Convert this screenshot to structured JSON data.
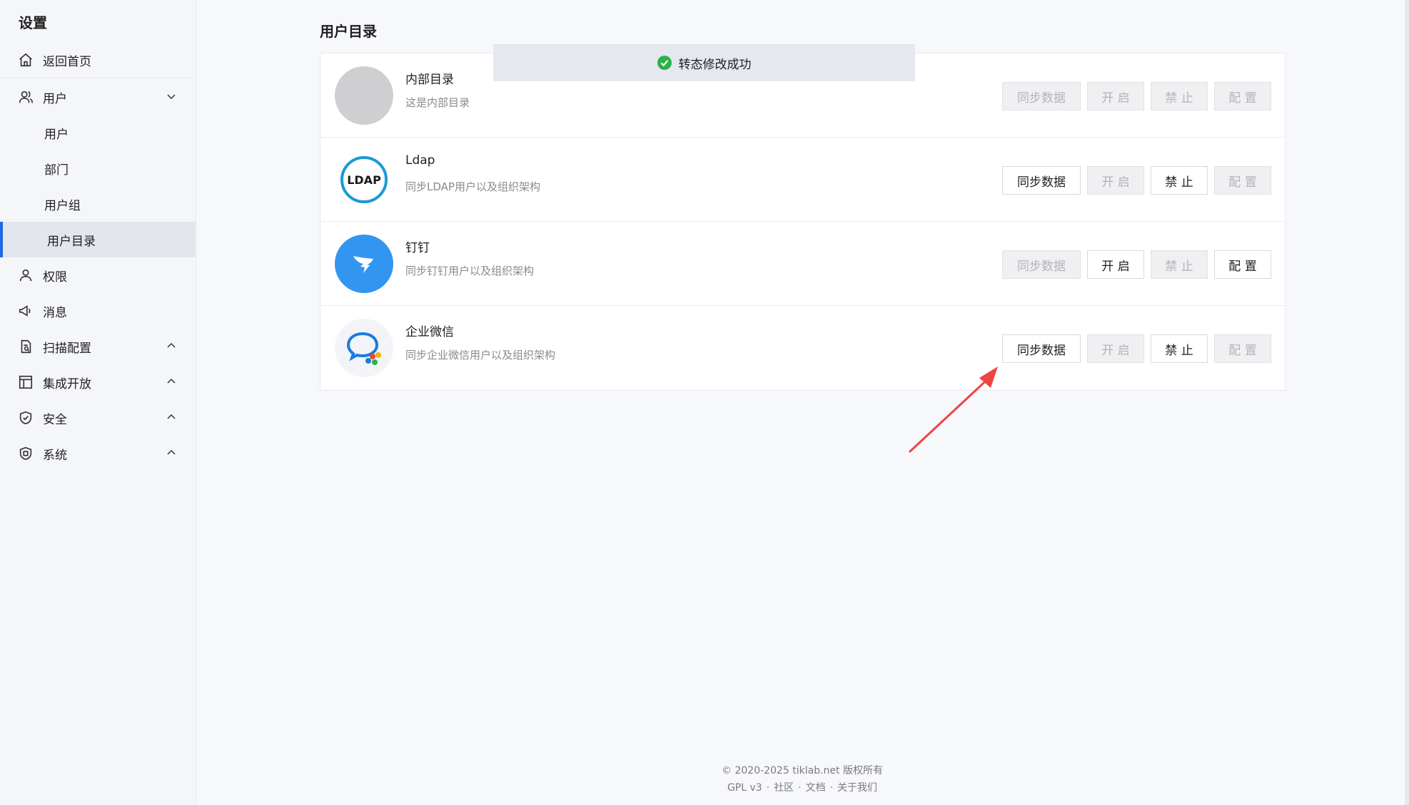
{
  "sidebar": {
    "title": "设置",
    "home": "返回首页",
    "users_group": "用户",
    "sub_items": [
      "用户",
      "部门",
      "用户组",
      "用户目录"
    ],
    "permission": "权限",
    "message": "消息",
    "scan_config": "扫描配置",
    "integration": "集成开放",
    "security": "安全",
    "system": "系统"
  },
  "main": {
    "title": "用户目录",
    "rows": [
      {
        "name": "内部目录",
        "desc": "这是内部目录",
        "logo": "grey-circle"
      },
      {
        "name": "Ldap",
        "desc": "同步LDAP用户以及组织架构",
        "logo": "ldap-icon",
        "logo_text": "LDAP"
      },
      {
        "name": "钉钉",
        "desc": "同步钉钉用户以及组织架构",
        "logo": "dingtalk-icon"
      },
      {
        "name": "企业微信",
        "desc": "同步企业微信用户以及组织架构",
        "logo": "wecom-icon"
      }
    ],
    "buttons": {
      "sync": "同步数据",
      "open": "开 启",
      "ban": "禁 止",
      "config": "配 置"
    }
  },
  "toast": {
    "message": "转态修改成功"
  },
  "footer": {
    "copyright": "© 2020-2025 tiklab.net 版权所有",
    "license": "GPL v3",
    "community": "社区",
    "docs": "文档",
    "about": "关于我们"
  },
  "colors": {
    "accent": "#1f6ae6",
    "success": "#2bb24c",
    "annotation_arrow": "#ef4444"
  }
}
